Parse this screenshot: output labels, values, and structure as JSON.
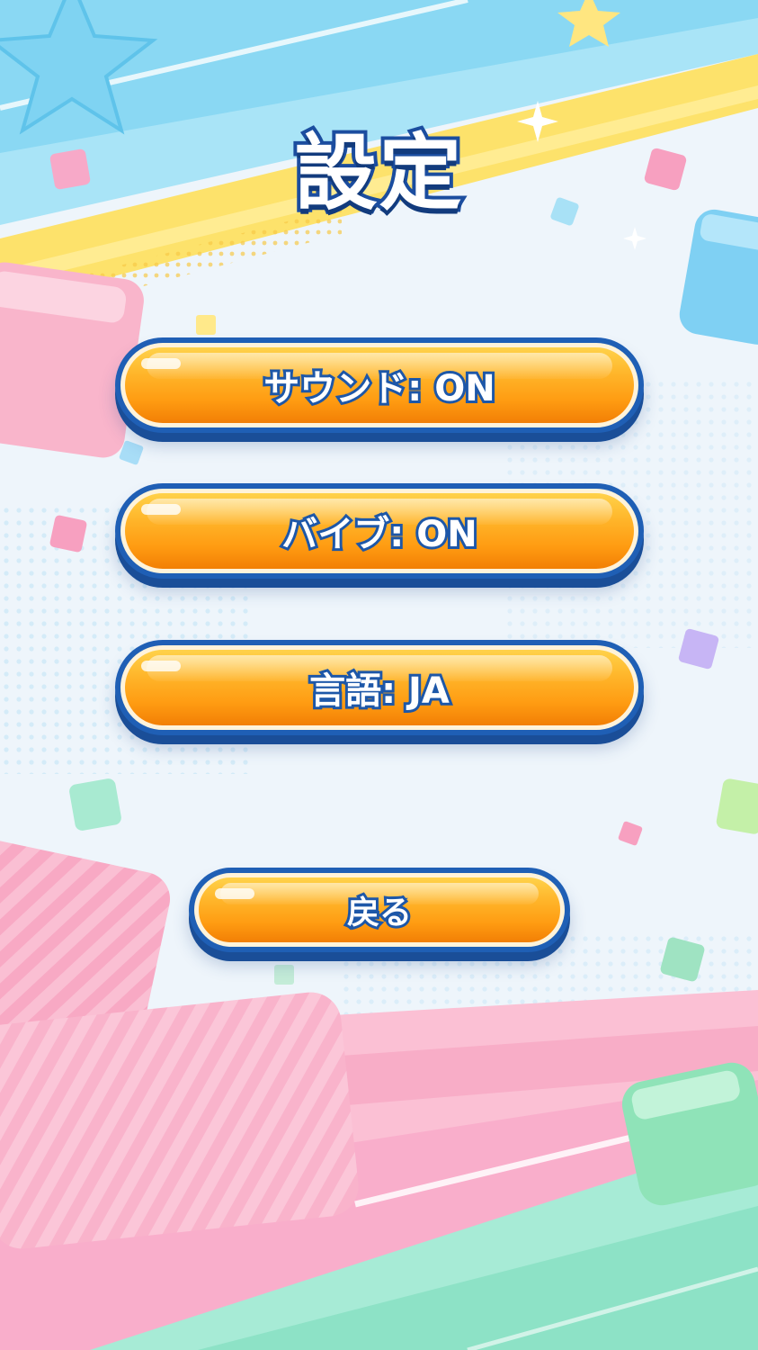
{
  "screen": {
    "title": "設定"
  },
  "settings": {
    "sound_label": "サウンド: ON",
    "vibration_label": "バイブ: ON",
    "language_label": "言語: JA"
  },
  "nav": {
    "back_label": "戻る"
  },
  "colors": {
    "button_orange": "#ff9c12",
    "button_outline": "#1f5fb5",
    "title_outline": "#1b4d9f",
    "background": "#eef5fb"
  }
}
